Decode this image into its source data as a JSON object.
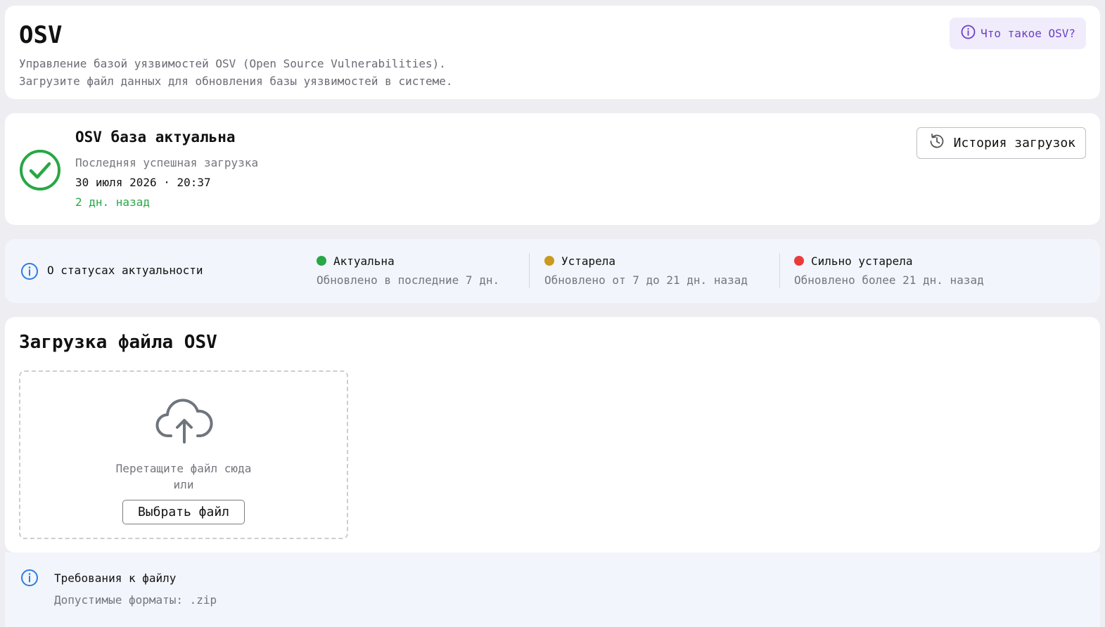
{
  "header": {
    "title": "OSV",
    "description_line1": "Управление базой уязвимостей OSV (Open Source Vulnerabilities).",
    "description_line2": "Загрузите файл данных для обновления базы уязвимостей в системе.",
    "what_is_button": "Что такое OSV?"
  },
  "status": {
    "title": "OSV база актуальна",
    "last_upload_label": "Последняя успешная загрузка",
    "last_upload_date": "30 июля 2026 · 20:37",
    "ago": "2 дн. назад",
    "history_button": "История загрузок",
    "state_color": "#28a745"
  },
  "legend": {
    "heading": "О статусах актуальности",
    "items": [
      {
        "label": "Актуальна",
        "description": "Обновлено в последние 7 дн.",
        "color": "#28a745"
      },
      {
        "label": "Устарела",
        "description": "Обновлено от 7 до 21 дн. назад",
        "color": "#c99a1e"
      },
      {
        "label": "Сильно устарела",
        "description": "Обновлено более 21 дн. назад",
        "color": "#ea3b3b"
      }
    ]
  },
  "upload": {
    "title": "Загрузка файла OSV",
    "drop_text": "Перетащите файл сюда",
    "or_text": "или",
    "choose_button": "Выбрать файл"
  },
  "requirements": {
    "title": "Требования к файлу",
    "formats": "Допустимые форматы: .zip"
  },
  "colors": {
    "accent_purple": "#6b40c8",
    "info_blue": "#2b7de0",
    "success_green": "#28a745"
  }
}
